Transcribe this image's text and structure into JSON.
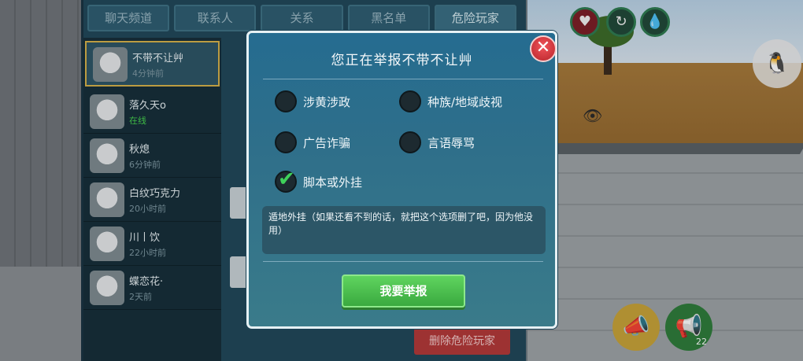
{
  "background_panel": {
    "tabs": [
      "聊天频道",
      "联系人",
      "关系",
      "黑名单",
      "危险玩家"
    ],
    "active_tab_index": 4,
    "players": [
      {
        "name": "不带不让艸",
        "status": "4分钟前"
      },
      {
        "name": "落久天o",
        "status": "在线"
      },
      {
        "name": "秋熄",
        "status": "6分钟前"
      },
      {
        "name": "白纹巧克力",
        "status": "20小时前"
      },
      {
        "name": "川丨饮",
        "status": "22小时前"
      },
      {
        "name": "蝶恋花·",
        "status": "2天前"
      }
    ],
    "delete_button_label": "删除危险玩家"
  },
  "hud": {
    "horn_count": "22"
  },
  "dialog": {
    "title": "您正在举报不带不让艸",
    "close_icon": "close-icon",
    "options": [
      {
        "label": "涉黄涉政",
        "checked": false
      },
      {
        "label": "种族/地域歧视",
        "checked": false
      },
      {
        "label": "广告诈骗",
        "checked": false
      },
      {
        "label": "言语辱骂",
        "checked": false
      },
      {
        "label": "脚本或外挂",
        "checked": true
      }
    ],
    "reason_text": "遁地外挂（如果还看不到的话，就把这个选项删了吧，因为他没用）",
    "submit_label": "我要举报"
  }
}
